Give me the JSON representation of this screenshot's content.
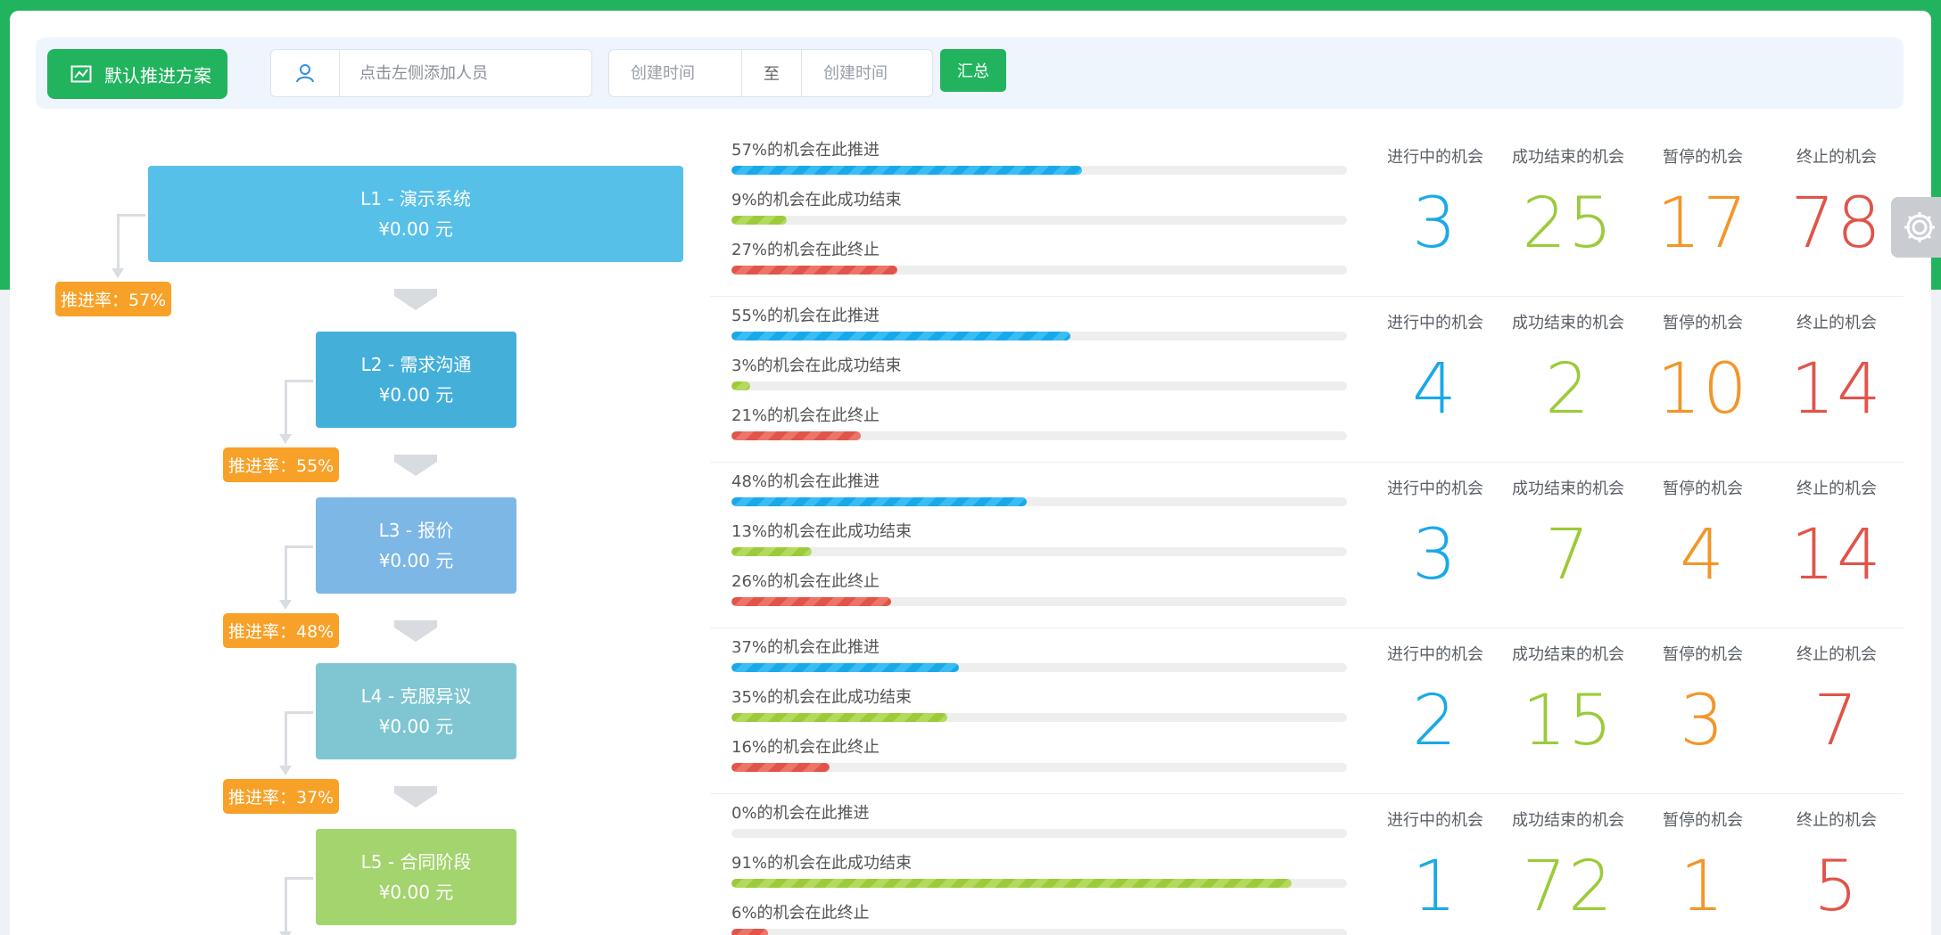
{
  "toolbar": {
    "plan_button": "默认推进方案",
    "person_placeholder": "点击左侧添加人员",
    "date_start_placeholder": "创建时间",
    "date_sep": "至",
    "date_end_placeholder": "创建时间",
    "summary_button": "汇总"
  },
  "colors": {
    "brand": "#22b35e",
    "progress": "#19a9e9",
    "success": "#9bcb3a",
    "paused": "#f2962a",
    "terminated": "#e0544a",
    "rate_badge": "#f7a128"
  },
  "stat_labels": [
    "进行中的机会",
    "成功结束的机会",
    "暂停的机会",
    "终止的机会"
  ],
  "stages": [
    {
      "name": "L1 - 演示系统",
      "amount": "¥0.00 元",
      "color": "#57c0e8",
      "rate_label": "推进率：57%",
      "bars": [
        {
          "label": "57%的机会在此推进",
          "pct": 57
        },
        {
          "label": "9%的机会在此成功结束",
          "pct": 9
        },
        {
          "label": "27%的机会在此终止",
          "pct": 27
        }
      ],
      "stats": [
        "3",
        "25",
        "17",
        "78"
      ]
    },
    {
      "name": "L2 - 需求沟通",
      "amount": "¥0.00 元",
      "color": "#44b0da",
      "rate_label": "推进率：55%",
      "bars": [
        {
          "label": "55%的机会在此推进",
          "pct": 55
        },
        {
          "label": "3%的机会在此成功结束",
          "pct": 3
        },
        {
          "label": "21%的机会在此终止",
          "pct": 21
        }
      ],
      "stats": [
        "4",
        "2",
        "10",
        "14"
      ]
    },
    {
      "name": "L3 - 报价",
      "amount": "¥0.00 元",
      "color": "#7db7e6",
      "rate_label": "推进率：48%",
      "bars": [
        {
          "label": "48%的机会在此推进",
          "pct": 48
        },
        {
          "label": "13%的机会在此成功结束",
          "pct": 13
        },
        {
          "label": "26%的机会在此终止",
          "pct": 26
        }
      ],
      "stats": [
        "3",
        "7",
        "4",
        "14"
      ]
    },
    {
      "name": "L4 - 克服异议",
      "amount": "¥0.00 元",
      "color": "#7fc6d2",
      "rate_label": "推进率：37%",
      "bars": [
        {
          "label": "37%的机会在此推进",
          "pct": 37
        },
        {
          "label": "35%的机会在此成功结束",
          "pct": 35
        },
        {
          "label": "16%的机会在此终止",
          "pct": 16
        }
      ],
      "stats": [
        "2",
        "15",
        "3",
        "7"
      ]
    },
    {
      "name": "L5 - 合同阶段",
      "amount": "¥0.00 元",
      "color": "#a3d46e",
      "rate_label": "",
      "bars": [
        {
          "label": "0%的机会在此推进",
          "pct": 0
        },
        {
          "label": "91%的机会在此成功结束",
          "pct": 91
        },
        {
          "label": "6%的机会在此终止",
          "pct": 6
        }
      ],
      "stats": [
        "1",
        "72",
        "1",
        "5"
      ]
    }
  ]
}
